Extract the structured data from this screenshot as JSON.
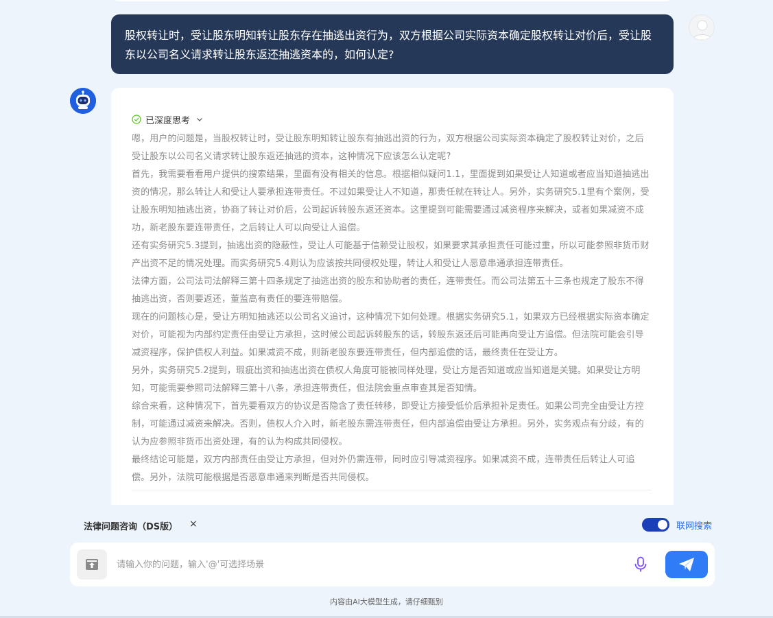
{
  "user_message": {
    "text": "股权转让时，受让股东明知转让股东存在抽逃出资行为，双方根据公司实际资本确定股权转让对价后，受让股东以公司名义请求转让股东返还抽逃资本的，如何认定?"
  },
  "answer": {
    "thinking_label": "已深度思考",
    "paragraphs": [
      "嗯，用户的问题是，当股权转让时，受让股东明知转让股东有抽逃出资的行为，双方根据公司实际资本确定了股权转让对价，之后受让股东以公司名义请求转让股东返还抽逃的资本，这种情况下应该怎么认定呢?",
      "首先，我需要看看用户提供的搜索结果，里面有没有相关的信息。根据相似疑问1.1，里面提到如果受让人知道或者应当知道抽逃出资的情况，那么转让人和受让人要承担连带责任。不过如果受让人不知道，那责任就在转让人。另外，实务研究5.1里有个案例，受让股东明知抽逃出资，协商了转让对价后，公司起诉转股东返还资本。这里提到可能需要通过减资程序来解决，或者如果减资不成功，新老股东要连带责任，之后转让人可以向受让人追偿。",
      "还有实务研究5.3提到，抽逃出资的隐蔽性，受让人可能基于信赖受让股权，如果要求其承担责任可能过重，所以可能参照非货币财产出资不足的情况处理。而实务研究5.4则认为应该按共同侵权处理，转让人和受让人恶意串通承担连带责任。",
      "法律方面，公司法司法解释三第十四条规定了抽逃出资的股东和协助者的责任，连带责任。而公司法第五十三条也规定了股东不得抽逃出资，否则要返还，董监高有责任的要连带赔偿。",
      "现在的问题核心是，受让方明知抽逃还以公司名义追讨，这种情况下如何处理。根据实务研究5.1，如果双方已经根据实际资本确定对价，可能视为内部约定责任由受让方承担，这时候公司起诉转股东的话，转股东返还后可能再向受让方追偿。但法院可能会引导减资程序，保护债权人利益。如果减资不成，则新老股东要连带责任，但内部追偿的话，最终责任在受让方。",
      "另外，实务研究5.2提到，瑕疵出资和抽逃出资在债权人角度可能被同样处理，受让方是否知道或应当知道是关键。如果受让方明知，可能需要参照司法解释三第十八条，承担连带责任，但法院会重点审查其是否知情。",
      "综合来看，这种情况下，首先要看双方的协议是否隐含了责任转移，即受让方接受低价后承担补足责任。如果公司完全由受让方控制，可能通过减资来解决。否则，债权人介入时，新老股东需连带责任，但内部追偿由受让方承担。另外，实务观点有分歧，有的认为应参照非货币出资处理，有的认为构成共同侵权。",
      "最终结论可能是，双方内部责任由受让方承担，但对外仍需连带，同时应引导减资程序。如果减资不成，连带责任后转让人可追偿。另外，法院可能根据是否恶意串通来判断是否共同侵权。"
    ]
  },
  "bottom": {
    "scene_label": "法律问题咨询（DS版）",
    "close_symbol": "×",
    "web_search_label": "联网搜索",
    "web_search_enabled": true,
    "input_placeholder": "请输入你的问题，输入'@'可选择场景",
    "disclaimer": "内容由AI大模型生成，请仔细甄别"
  },
  "icons": {
    "user_avatar": "user-avatar-icon",
    "bot_avatar": "robot-icon",
    "thinking": "check-circle-icon",
    "expand": "chevron-down-icon",
    "upload": "upload-tray-icon",
    "mic": "microphone-icon",
    "send": "paper-plane-icon"
  },
  "colors": {
    "user_bubble": "#253858",
    "accent": "#2f7cf6",
    "toggle": "#1a3fb8",
    "link": "#2b6cf0",
    "check": "#52c41a",
    "mic": "#7c4dff"
  }
}
